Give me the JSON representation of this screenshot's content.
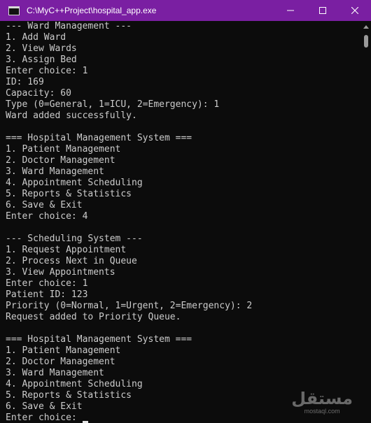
{
  "window": {
    "title": "C:\\MyC++Project\\hospital_app.exe"
  },
  "console": {
    "lines": [
      "--- Ward Management ---",
      "1. Add Ward",
      "2. View Wards",
      "3. Assign Bed",
      "Enter choice: 1",
      "ID: 169",
      "Capacity: 60",
      "Type (0=General, 1=ICU, 2=Emergency): 1",
      "Ward added successfully.",
      "",
      "=== Hospital Management System ===",
      "1. Patient Management",
      "2. Doctor Management",
      "3. Ward Management",
      "4. Appointment Scheduling",
      "5. Reports & Statistics",
      "6. Save & Exit",
      "Enter choice: 4",
      "",
      "--- Scheduling System ---",
      "1. Request Appointment",
      "2. Process Next in Queue",
      "3. View Appointments",
      "Enter choice: 1",
      "Patient ID: 123",
      "Priority (0=Normal, 1=Urgent, 2=Emergency): 2",
      "Request added to Priority Queue.",
      "",
      "=== Hospital Management System ===",
      "1. Patient Management",
      "2. Doctor Management",
      "3. Ward Management",
      "4. Appointment Scheduling",
      "5. Reports & Statistics",
      "6. Save & Exit"
    ],
    "prompt": "Enter choice: "
  },
  "watermark": {
    "logo": "مستقل",
    "url": "mostaql.com"
  },
  "colors": {
    "titlebar": "#7a1fa2",
    "background": "#0c0c0c",
    "text": "#cccccc"
  },
  "icons": {
    "app": "console-app-icon",
    "minimize": "minimize-icon",
    "maximize": "maximize-icon",
    "close": "close-icon"
  }
}
